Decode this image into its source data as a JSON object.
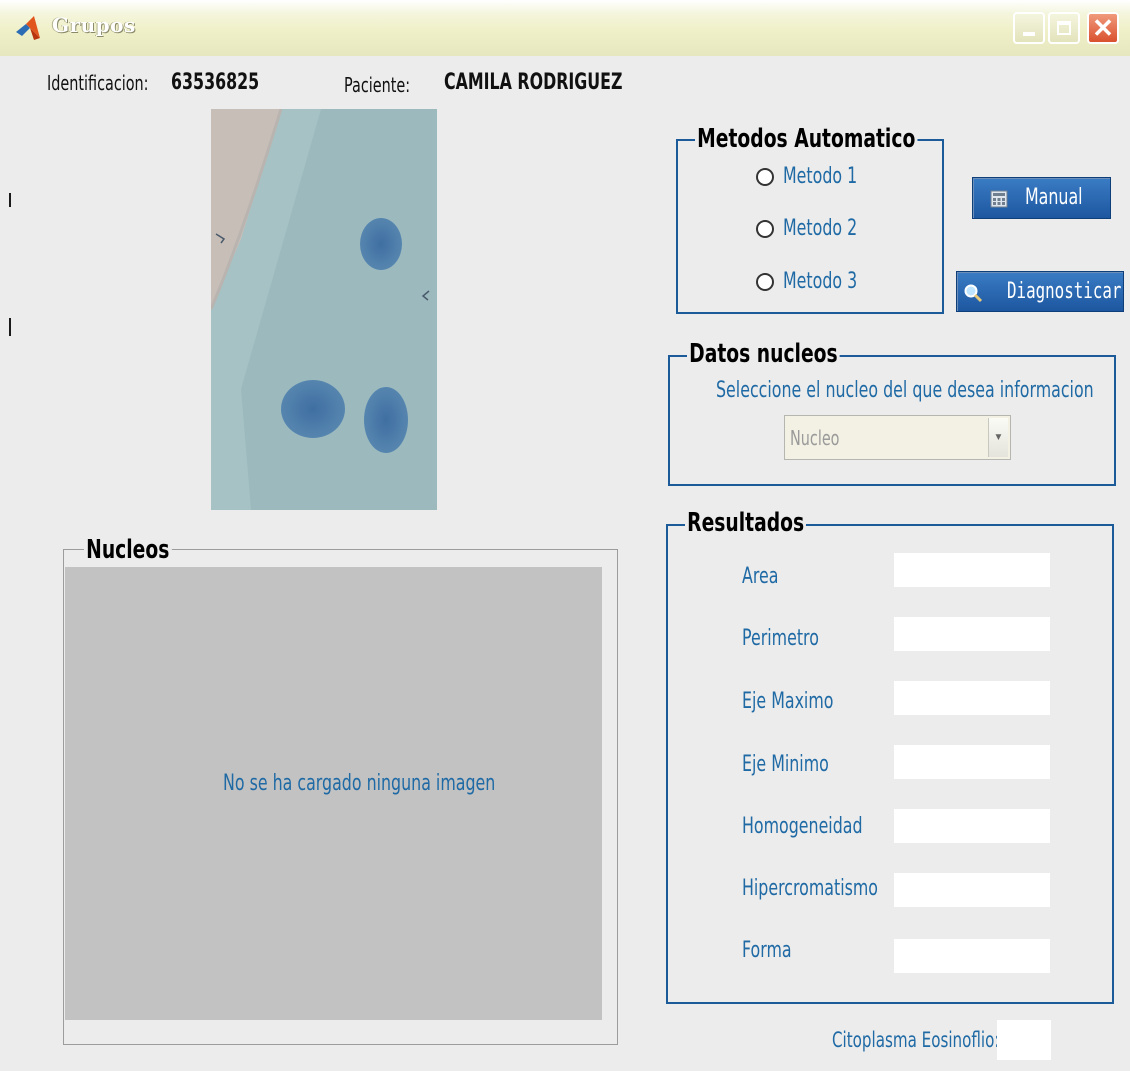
{
  "window": {
    "title": "Grupos",
    "icon": "matlab-icon",
    "controls": [
      "minimize-icon",
      "maximize-icon",
      "close-icon"
    ]
  },
  "patient": {
    "id_label": "Identificacion:",
    "id_value": "63536825",
    "name_label": "Paciente:",
    "name_value": "CAMILA RODRIGUEZ"
  },
  "auto_methods": {
    "title": "Metodos Automatico",
    "options": [
      "Metodo 1",
      "Metodo 2",
      "Metodo 3"
    ]
  },
  "buttons": {
    "manual": "Manual",
    "manual_icon": "calculator-icon",
    "diagnosticar": "Diagnosticar",
    "diagnosticar_icon": "magnifier-icon"
  },
  "datos_nucleos": {
    "title": "Datos nucleos",
    "instruction": "Seleccione el nucleo del que desea informacion",
    "select_value": "Nucleo"
  },
  "resultados": {
    "title": "Resultados",
    "fields": [
      "Area",
      "Perimetro",
      "Eje Maximo",
      "Eje Minimo",
      "Homogeneidad",
      "Hipercromatismo",
      "Forma"
    ]
  },
  "nucleos": {
    "title": "Nucleos",
    "empty_message": "No se ha cargado ninguna imagen"
  },
  "citoplasma": {
    "label": "Citoplasma Eosinoflio:"
  },
  "colors": {
    "frame_blue": "#1b5b9a",
    "text_blue": "#1f6aa5",
    "button_blue": "#2a68b2",
    "panel_gray": "#c2c2c2"
  }
}
